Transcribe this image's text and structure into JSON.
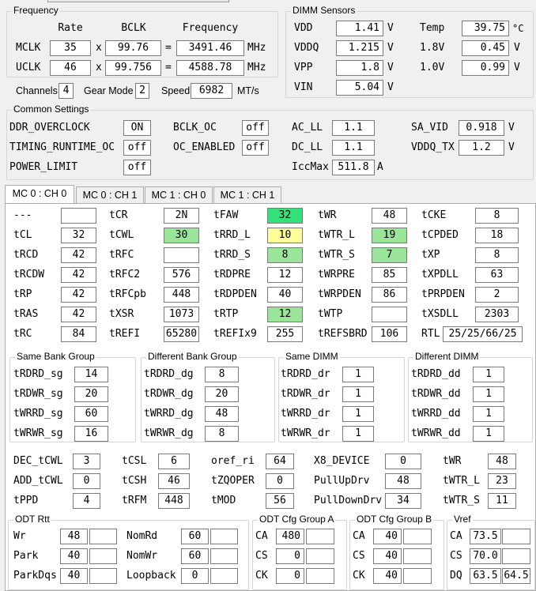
{
  "frequency": {
    "title": "Frequency",
    "headers": {
      "rate": "Rate",
      "bclk": "BCLK",
      "freq": "Frequency"
    },
    "rows": [
      {
        "label": "MCLK",
        "rate": "35",
        "x": "x",
        "bclk": "99.76",
        "eq": "=",
        "freq": "3491.46",
        "unit": "MHz"
      },
      {
        "label": "UCLK",
        "rate": "46",
        "x": "x",
        "bclk": "99.756",
        "eq": "=",
        "freq": "4588.78",
        "unit": "MHz"
      }
    ],
    "channels_label": "Channels",
    "channels": "4",
    "gear_label": "Gear Mode",
    "gear": "2",
    "speed_label": "Speed",
    "speed": "6982",
    "speed_unit": "MT/s"
  },
  "dimm": {
    "title": "DIMM Sensors",
    "vdd": {
      "label": "VDD",
      "value": "1.41",
      "unit": "V"
    },
    "vddq": {
      "label": "VDDQ",
      "value": "1.215",
      "unit": "V"
    },
    "vpp": {
      "label": "VPP",
      "value": "1.8",
      "unit": "V"
    },
    "vin": {
      "label": "VIN",
      "value": "5.04",
      "unit": "V"
    },
    "temp": {
      "label": "Temp",
      "value": "39.75",
      "unit": "°C"
    },
    "v18": {
      "label": "1.8V",
      "value": "0.45",
      "unit": "V"
    },
    "v10": {
      "label": "1.0V",
      "value": "0.99",
      "unit": "V"
    }
  },
  "common": {
    "title": "Common Settings",
    "ddr_oc": {
      "label": "DDR_OVERCLOCK",
      "value": "ON"
    },
    "timing_rt": {
      "label": "TIMING_RUNTIME_OC",
      "value": "off"
    },
    "power_limit": {
      "label": "POWER_LIMIT",
      "value": "off"
    },
    "bclk_oc": {
      "label": "BCLK_OC",
      "value": "off"
    },
    "oc_enabled": {
      "label": "OC_ENABLED",
      "value": "off"
    },
    "ac_ll": {
      "label": "AC_LL",
      "value": "1.1"
    },
    "dc_ll": {
      "label": "DC_LL",
      "value": "1.1"
    },
    "iccmax": {
      "label": "IccMax",
      "value": "511.8",
      "unit": "A"
    },
    "sa_vid": {
      "label": "SA_VID",
      "value": "0.918",
      "unit": "V"
    },
    "vddq_tx": {
      "label": "VDDQ_TX",
      "value": "1.2",
      "unit": "V"
    }
  },
  "tabs": [
    "MC 0 : CH 0",
    "MC 0 : CH 1",
    "MC 1 : CH 0",
    "MC 1 : CH 1"
  ],
  "colors": {
    "green_bright": "#33e07a",
    "green_light": "#9be59b",
    "yellow": "#ffff99",
    "panel": "#ffffff",
    "bg": "#f0f0f0"
  },
  "timings": {
    "c1": [
      [
        "---",
        ""
      ],
      [
        "tCL",
        "32"
      ],
      [
        "tRCD",
        "42"
      ],
      [
        "tRCDW",
        "42"
      ],
      [
        "tRP",
        "42"
      ],
      [
        "tRAS",
        "42"
      ],
      [
        "tRC",
        "84"
      ]
    ],
    "c2": [
      [
        "tCR",
        "2N"
      ],
      [
        "tCWL",
        "30"
      ],
      [
        "tRFC",
        ""
      ],
      [
        "tRFC2",
        "576"
      ],
      [
        "tRFCpb",
        "448"
      ],
      [
        "tXSR",
        "1073"
      ],
      [
        "tREFI",
        "65280"
      ]
    ],
    "c3": [
      [
        "tFAW",
        "32"
      ],
      [
        "tRRD_L",
        "10"
      ],
      [
        "tRRD_S",
        "8"
      ],
      [
        "tRDPRE",
        "12"
      ],
      [
        "tRDPDEN",
        "40"
      ],
      [
        "tRTP",
        "12"
      ],
      [
        "tREFIx9",
        "255"
      ]
    ],
    "c4": [
      [
        "tWR",
        "48"
      ],
      [
        "tWTR_L",
        "19"
      ],
      [
        "tWTR_S",
        "7"
      ],
      [
        "tWRPRE",
        "85"
      ],
      [
        "tWRPDEN",
        "86"
      ],
      [
        "tWTP",
        ""
      ],
      [
        "tREFSBRD",
        "106"
      ]
    ],
    "c5": [
      [
        "tCKE",
        "8"
      ],
      [
        "tCPDED",
        "18"
      ],
      [
        "tXP",
        "8"
      ],
      [
        "tXPDLL",
        "63"
      ],
      [
        "tPRPDEN",
        "2"
      ],
      [
        "tXSDLL",
        "2303"
      ],
      [
        "RTL",
        "25/25/66/25"
      ]
    ]
  },
  "bank_groups": [
    {
      "title": "Same Bank Group",
      "rows": [
        [
          "tRDRD_sg",
          "14"
        ],
        [
          "tRDWR_sg",
          "20"
        ],
        [
          "tWRRD_sg",
          "60"
        ],
        [
          "tWRWR_sg",
          "16"
        ]
      ]
    },
    {
      "title": "Different Bank Group",
      "rows": [
        [
          "tRDRD_dg",
          "8"
        ],
        [
          "tRDWR_dg",
          "20"
        ],
        [
          "tWRRD_dg",
          "48"
        ],
        [
          "tWRWR_dg",
          "8"
        ]
      ]
    },
    {
      "title": "Same DIMM",
      "rows": [
        [
          "tRDRD_dr",
          "1"
        ],
        [
          "tRDWR_dr",
          "1"
        ],
        [
          "tWRRD_dr",
          "1"
        ],
        [
          "tWRWR_dr",
          "1"
        ]
      ]
    },
    {
      "title": "Different DIMM",
      "rows": [
        [
          "tRDRD_dd",
          "1"
        ],
        [
          "tRDWR_dd",
          "1"
        ],
        [
          "tWRRD_dd",
          "1"
        ],
        [
          "tWRWR_dd",
          "1"
        ]
      ]
    }
  ],
  "misc": {
    "c1": [
      [
        "DEC_tCWL",
        "3"
      ],
      [
        "ADD_tCWL",
        "0"
      ],
      [
        "tPPD",
        "4"
      ]
    ],
    "c2": [
      [
        "tCSL",
        "6"
      ],
      [
        "tCSH",
        "46"
      ],
      [
        "tRFM",
        "448"
      ]
    ],
    "c3": [
      [
        "oref_ri",
        "64"
      ],
      [
        "tZQOPER",
        "0"
      ],
      [
        "tMOD",
        "56"
      ]
    ],
    "c4": [
      [
        "X8_DEVICE",
        "0"
      ],
      [
        "PullUpDrv",
        "48"
      ],
      [
        "PullDownDrv",
        "34"
      ]
    ],
    "c5": [
      [
        "tWR",
        "48"
      ],
      [
        "tWTR_L",
        "23"
      ],
      [
        "tWTR_S",
        "11"
      ]
    ]
  },
  "odt": {
    "title": "ODT Rtt",
    "c1": [
      [
        "Wr",
        "48",
        ""
      ],
      [
        "Park",
        "40",
        ""
      ],
      [
        "ParkDqs",
        "40",
        ""
      ]
    ],
    "c2": [
      [
        "NomRd",
        "60",
        ""
      ],
      [
        "NomWr",
        "60",
        ""
      ],
      [
        "Loopback",
        "0",
        ""
      ]
    ]
  },
  "odt_a": {
    "title": "ODT Cfg Group A",
    "rows": [
      [
        "CA",
        "480",
        ""
      ],
      [
        "CS",
        "0",
        ""
      ],
      [
        "CK",
        "0",
        ""
      ]
    ]
  },
  "odt_b": {
    "title": "ODT Cfg Group B",
    "rows": [
      [
        "CA",
        "40",
        ""
      ],
      [
        "CS",
        "40",
        ""
      ],
      [
        "CK",
        "40",
        ""
      ]
    ]
  },
  "vref": {
    "title": "Vref",
    "rows": [
      [
        "CA",
        "73.5",
        ""
      ],
      [
        "CS",
        "70.0",
        ""
      ],
      [
        "DQ",
        "63.5",
        "64.5"
      ]
    ]
  }
}
